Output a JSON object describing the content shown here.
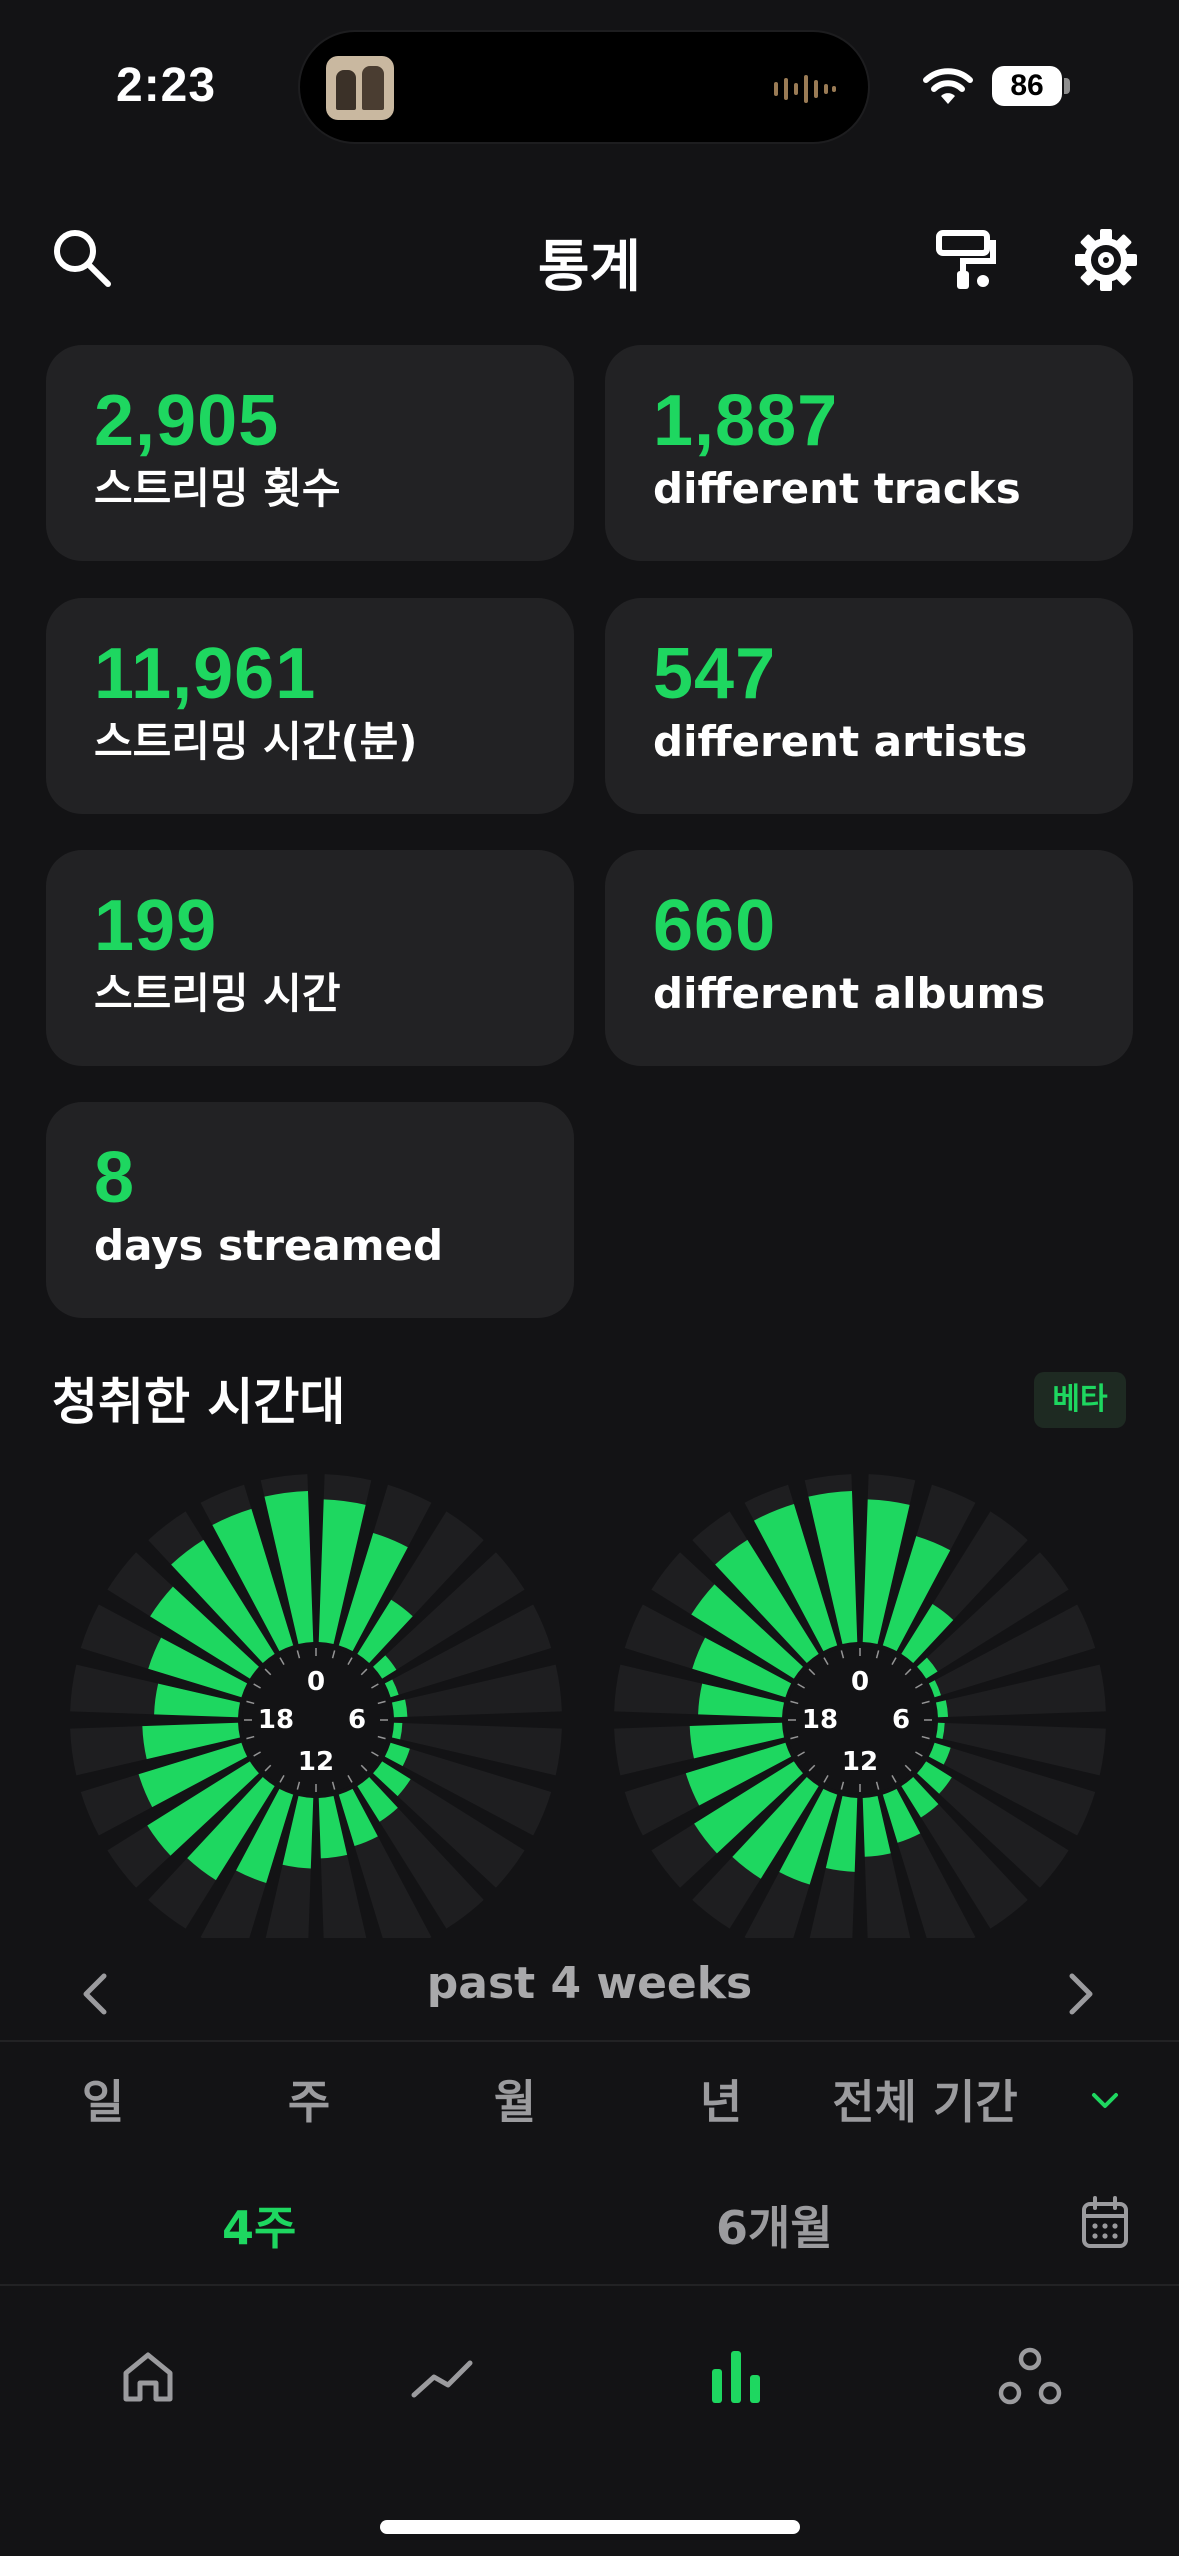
{
  "status_bar": {
    "time": "2:23",
    "battery": "86"
  },
  "header": {
    "title": "통계"
  },
  "stats": [
    {
      "value": "2,905",
      "label": "스트리밍 횟수"
    },
    {
      "value": "1,887",
      "label": "different tracks"
    },
    {
      "value": "11,961",
      "label": "스트리밍 시간(분)"
    },
    {
      "value": "547",
      "label": "different artists"
    },
    {
      "value": "199",
      "label": "스트리밍 시간"
    },
    {
      "value": "660",
      "label": "different albums"
    },
    {
      "value": "8",
      "label": "days streamed"
    }
  ],
  "listening_hours": {
    "title": "청취한 시간대",
    "badge": "베타",
    "clock_labels": {
      "top": "0",
      "right": "6",
      "bottom": "12",
      "left": "18"
    },
    "period": "past 4 weeks"
  },
  "chart_data": [
    {
      "type": "polar-bar",
      "x": [
        0,
        1,
        2,
        3,
        4,
        5,
        6,
        7,
        8,
        9,
        10,
        11,
        12,
        13,
        14,
        15,
        16,
        17,
        18,
        19,
        20,
        21,
        22,
        23
      ],
      "values": [
        0.85,
        0.7,
        0.38,
        0.1,
        0.05,
        0.08,
        0.05,
        0.12,
        0.2,
        0.25,
        0.32,
        0.36,
        0.42,
        0.55,
        0.66,
        0.72,
        0.64,
        0.57,
        0.5,
        0.58,
        0.7,
        0.8,
        0.85,
        0.9
      ]
    },
    {
      "type": "polar-bar",
      "x": [
        0,
        1,
        2,
        3,
        4,
        5,
        6,
        7,
        8,
        9,
        10,
        11,
        12,
        13,
        14,
        15,
        16,
        17,
        18,
        19,
        20,
        21,
        22,
        23
      ],
      "values": [
        0.85,
        0.68,
        0.35,
        0.08,
        0.04,
        0.06,
        0.04,
        0.1,
        0.18,
        0.22,
        0.3,
        0.35,
        0.44,
        0.56,
        0.65,
        0.7,
        0.62,
        0.55,
        0.5,
        0.58,
        0.72,
        0.8,
        0.88,
        0.9
      ]
    }
  ],
  "range_tabs": [
    "일",
    "주",
    "월",
    "년",
    "전체 기간"
  ],
  "sub_tabs": {
    "active": "4주",
    "other": "6개월"
  },
  "colors": {
    "accent": "#1ed760",
    "card": "#222224",
    "background": "#131315"
  },
  "nav_icons": [
    "home-icon",
    "trend-icon",
    "stats-icon",
    "community-icon"
  ]
}
